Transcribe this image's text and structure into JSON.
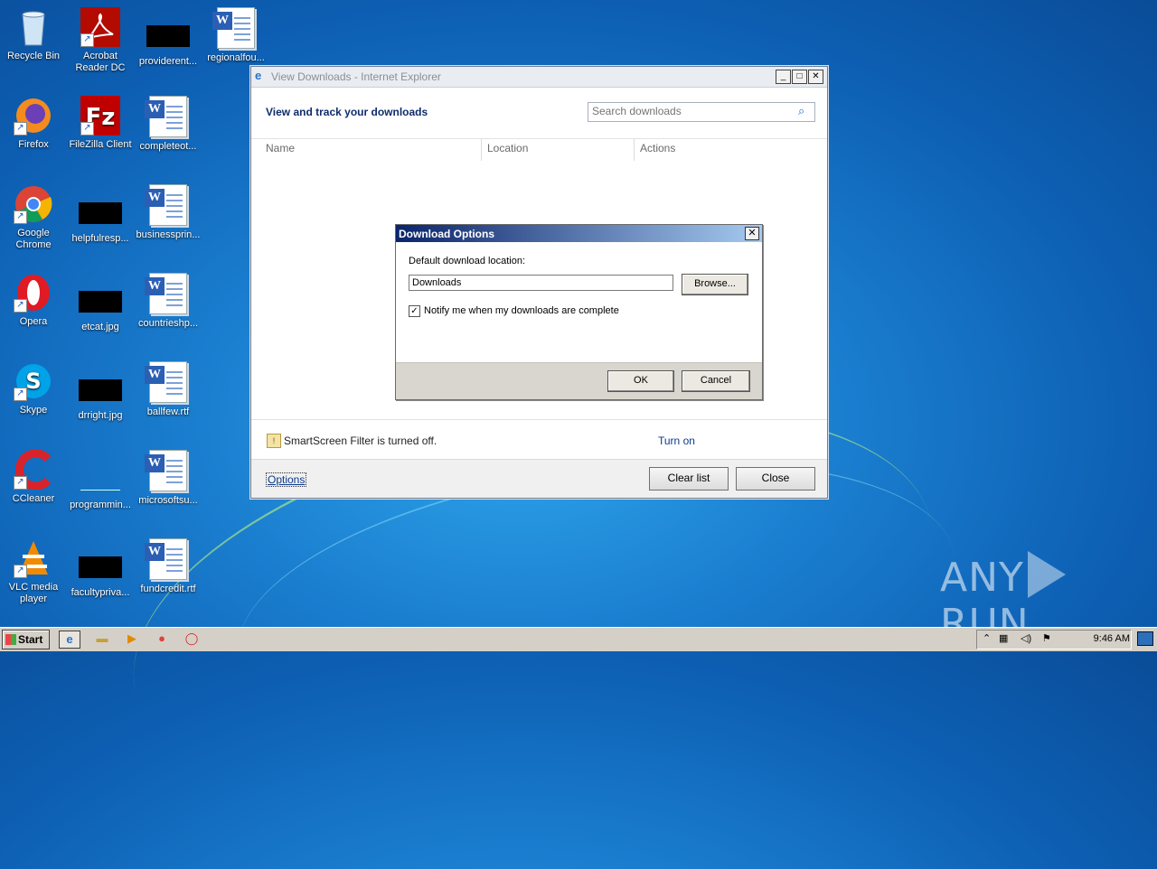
{
  "desktop": {
    "icons": [
      {
        "label": "Recycle Bin",
        "icon": "recycle-bin-icon"
      },
      {
        "label": "Acrobat Reader DC",
        "icon": "acrobat-icon"
      },
      {
        "label": "providerent...",
        "icon": "black-thumbnail"
      },
      {
        "label": "regionalfou...",
        "icon": "word-document-icon"
      },
      {
        "label": "Firefox",
        "icon": "firefox-icon"
      },
      {
        "label": "FileZilla Client",
        "icon": "filezilla-icon"
      },
      {
        "label": "completeot...",
        "icon": "word-document-icon"
      },
      {
        "label": "Google Chrome",
        "icon": "chrome-icon"
      },
      {
        "label": "helpfulresp...",
        "icon": "black-thumbnail"
      },
      {
        "label": "businessprin...",
        "icon": "word-document-icon"
      },
      {
        "label": "Opera",
        "icon": "opera-icon"
      },
      {
        "label": "etcat.jpg",
        "icon": "black-thumbnail"
      },
      {
        "label": "countrieshp...",
        "icon": "word-document-icon"
      },
      {
        "label": "Skype",
        "icon": "skype-icon"
      },
      {
        "label": "drright.jpg",
        "icon": "black-thumbnail"
      },
      {
        "label": "ballfew.rtf",
        "icon": "word-document-icon"
      },
      {
        "label": "CCleaner",
        "icon": "ccleaner-icon"
      },
      {
        "label": "programmin...",
        "icon": "image-thumbnail"
      },
      {
        "label": "microsoftsu...",
        "icon": "word-document-icon"
      },
      {
        "label": "VLC media player",
        "icon": "vlc-icon"
      },
      {
        "label": "facultypriva...",
        "icon": "black-thumbnail"
      },
      {
        "label": "fundcredit.rtf",
        "icon": "word-document-icon"
      }
    ]
  },
  "ie_window": {
    "title": "View Downloads - Internet Explorer",
    "heading": "View and track your downloads",
    "search_placeholder": "Search downloads",
    "columns": [
      "Name",
      "Location",
      "Actions"
    ],
    "smartscreen_text": "SmartScreen Filter is turned off.",
    "turn_on_label": "Turn on",
    "options_label": "Options",
    "clear_list_label": "Clear list",
    "close_label": "Close"
  },
  "dialog": {
    "title": "Download Options",
    "location_label": "Default download location:",
    "location_value": "Downloads",
    "browse_label": "Browse...",
    "notify_label": "Notify me when my downloads are complete",
    "notify_checked": true,
    "ok_label": "OK",
    "cancel_label": "Cancel"
  },
  "taskbar": {
    "start_label": "Start",
    "clock": "9:46 AM"
  },
  "watermark": {
    "left": "ANY",
    "right": "RUN"
  }
}
